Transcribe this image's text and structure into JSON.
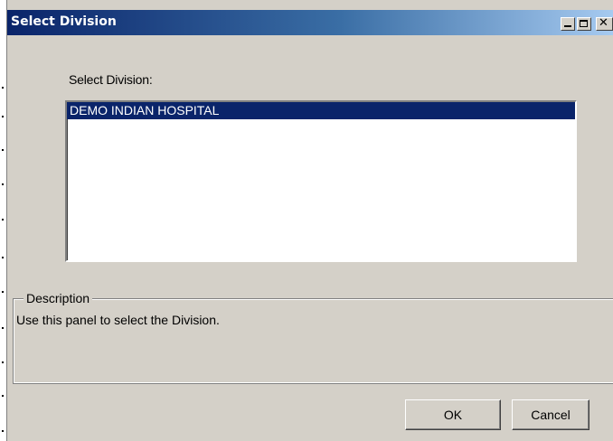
{
  "window": {
    "title": "Select Division",
    "minimize_icon": "minimize-icon",
    "maximize_icon": "maximize-icon",
    "close_icon": "close-icon",
    "close_glyph": "✕"
  },
  "division": {
    "label": "Select Division:",
    "items": [
      {
        "label": "DEMO INDIAN HOSPITAL",
        "selected": true
      }
    ]
  },
  "description": {
    "legend": "Description",
    "text": "Use this panel to select the Division."
  },
  "buttons": {
    "ok_label": "OK",
    "cancel_label": "Cancel"
  },
  "colors": {
    "titlebar_start": "#0a246a",
    "titlebar_end": "#a6caf0",
    "face": "#d4d0c8",
    "selection": "#0a246a"
  }
}
